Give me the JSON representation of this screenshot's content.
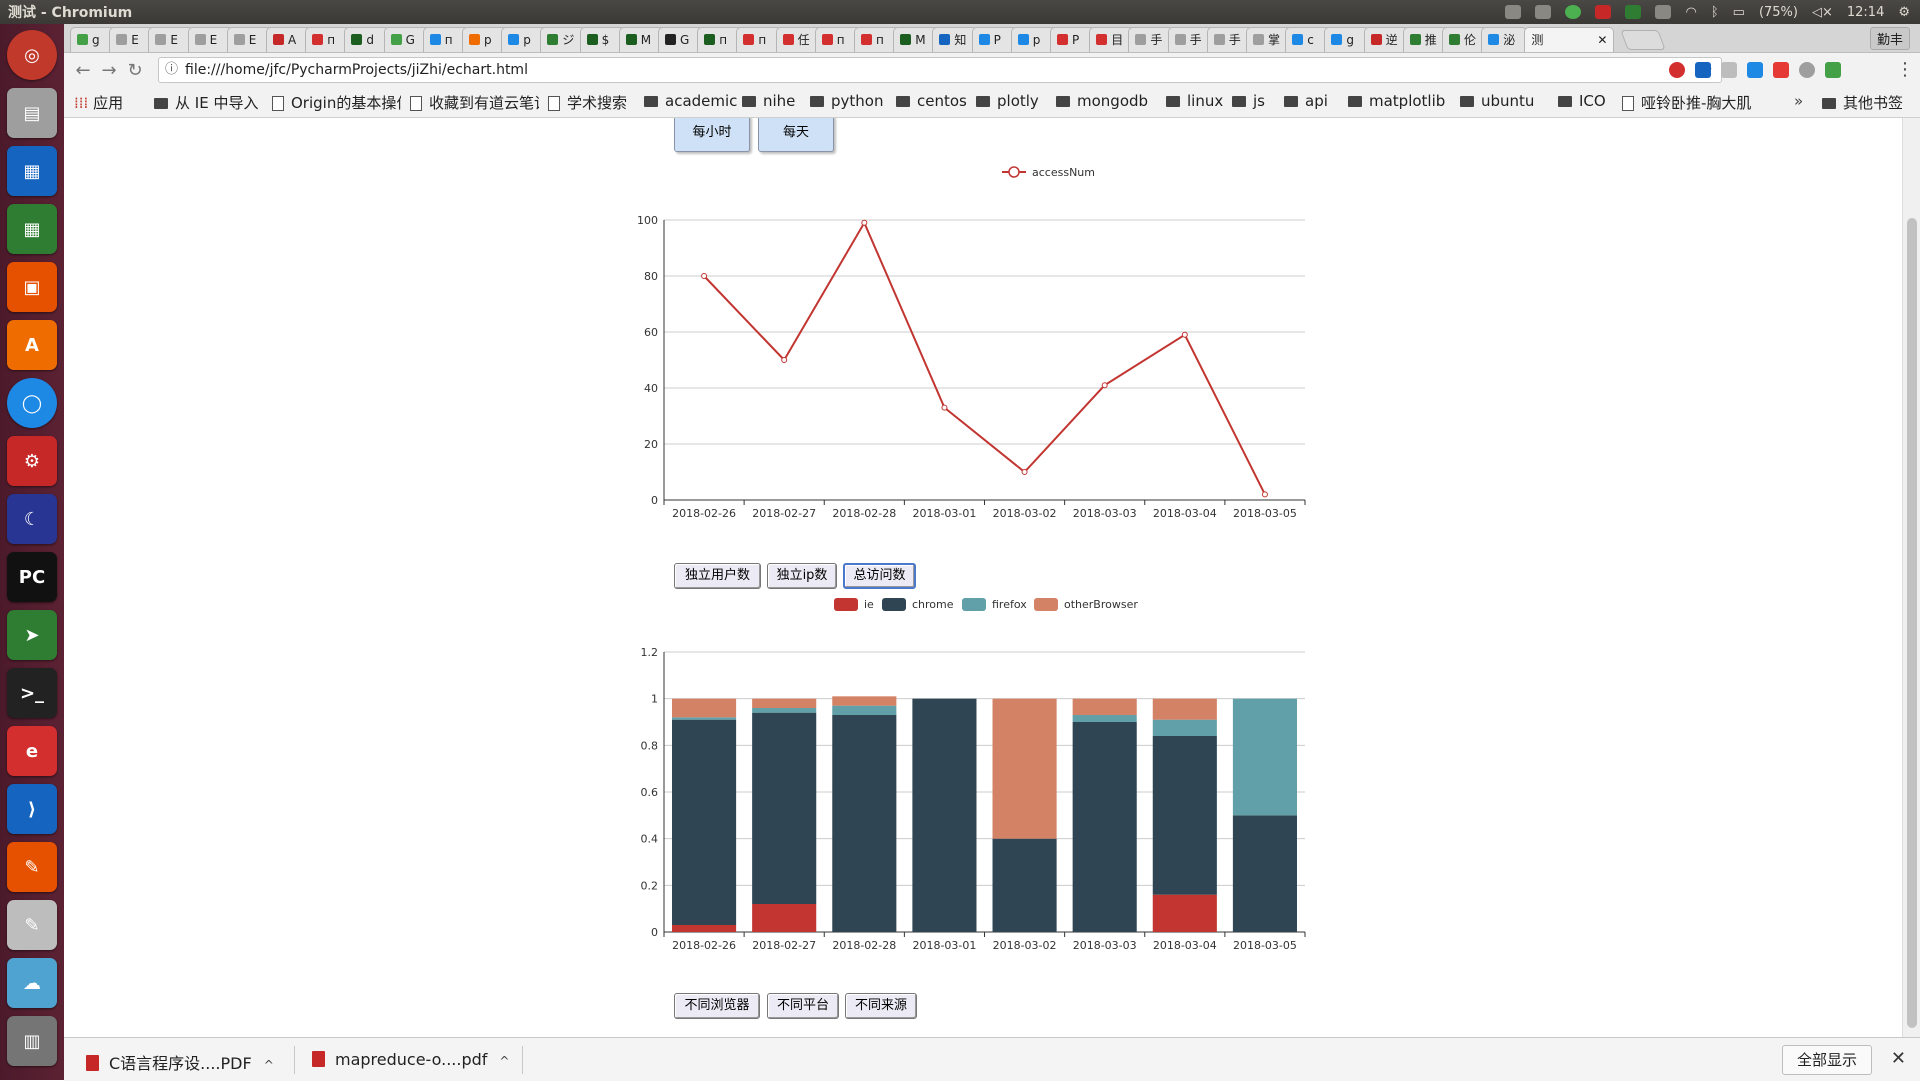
{
  "window": {
    "title": "测试 - Chromium"
  },
  "system": {
    "battery": "(75%)",
    "time": "12:14"
  },
  "tabs": {
    "items": [
      "g",
      "E",
      "E",
      "E",
      "E",
      "A",
      "п",
      "d",
      "G",
      "п",
      "р",
      "р",
      "ジ",
      "$",
      "M",
      "G",
      "п",
      "п",
      "任",
      "п",
      "п",
      "M",
      "知",
      "P",
      "р",
      "P",
      "目",
      "手",
      "手",
      "手",
      "掌",
      "c",
      "g",
      "逆",
      "推",
      "伦",
      "泌"
    ],
    "active": "测",
    "close": "✕",
    "menu_label": "勤丰"
  },
  "toolbar": {
    "url": "file:///home/jfc/PycharmProjects/jiZhi/echart.html",
    "back_icon": "back-arrow-icon",
    "forward_icon": "forward-arrow-icon",
    "reload_icon": "reload-icon"
  },
  "bookmarks": {
    "items": [
      {
        "label": "应用",
        "kind": "apps"
      },
      {
        "label": "从 IE 中导入",
        "kind": "folder"
      },
      {
        "label": "Origin的基本操作",
        "kind": "page"
      },
      {
        "label": "收藏到有道云笔记",
        "kind": "page"
      },
      {
        "label": "学术搜索",
        "kind": "page"
      },
      {
        "label": "academic",
        "kind": "folder"
      },
      {
        "label": "nihe",
        "kind": "folder"
      },
      {
        "label": "python",
        "kind": "folder"
      },
      {
        "label": "centos",
        "kind": "folder"
      },
      {
        "label": "plotly",
        "kind": "folder"
      },
      {
        "label": "mongodb",
        "kind": "folder"
      },
      {
        "label": "linux",
        "kind": "folder"
      },
      {
        "label": "js",
        "kind": "folder"
      },
      {
        "label": "api",
        "kind": "folder"
      },
      {
        "label": "matplotlib",
        "kind": "folder"
      },
      {
        "label": "ubuntu",
        "kind": "folder"
      },
      {
        "label": "ICO",
        "kind": "folder"
      },
      {
        "label": "哑铃卧推-胸大肌",
        "kind": "page"
      }
    ],
    "overflow": "»",
    "other": "其他书签"
  },
  "controls": {
    "granularity": [
      "每小时",
      "每天"
    ],
    "metric": [
      "独立用户数",
      "独立ip数",
      "总访问数"
    ],
    "metric_selected": 2,
    "dimension": [
      "不同浏览器",
      "不同平台",
      "不同来源"
    ]
  },
  "chart_data": [
    {
      "type": "line",
      "x": [
        "2018-02-26",
        "2018-02-27",
        "2018-02-28",
        "2018-03-01",
        "2018-03-02",
        "2018-03-03",
        "2018-03-04",
        "2018-03-05"
      ],
      "series": [
        {
          "name": "accessNum",
          "values": [
            80,
            50,
            99,
            33,
            10,
            41,
            59,
            2
          ],
          "color": "#c23531"
        }
      ],
      "ylim": [
        0,
        100
      ],
      "yticks": [
        0,
        20,
        40,
        60,
        80,
        100
      ],
      "grid": true,
      "legend": "top-center"
    },
    {
      "type": "bar",
      "stacked": true,
      "categories": [
        "2018-02-26",
        "2018-02-27",
        "2018-02-28",
        "2018-03-01",
        "2018-03-02",
        "2018-03-03",
        "2018-03-04",
        "2018-03-05"
      ],
      "series": [
        {
          "name": "ie",
          "color": "#c23531",
          "values": [
            0.03,
            0.12,
            0,
            0,
            0,
            0,
            0.16,
            0
          ]
        },
        {
          "name": "chrome",
          "color": "#2f4554",
          "values": [
            0.88,
            0.82,
            0.93,
            1.0,
            0.4,
            0.9,
            0.68,
            0.5
          ]
        },
        {
          "name": "firefox",
          "color": "#61a0a8",
          "values": [
            0.01,
            0.02,
            0.04,
            0,
            0,
            0.03,
            0.07,
            0.5
          ]
        },
        {
          "name": "otherBrowser",
          "color": "#d48265",
          "values": [
            0.08,
            0.04,
            0.04,
            0,
            0.6,
            0.07,
            0.09,
            0
          ]
        }
      ],
      "ylim": [
        0,
        1.2
      ],
      "yticks": [
        "0",
        "0.2",
        "0.4",
        "0.6",
        "0.8",
        "1",
        "1.2"
      ],
      "grid": true,
      "legend": "top-center"
    }
  ],
  "downloads": {
    "items": [
      "C语言程序设....PDF",
      "mapreduce-o....pdf"
    ],
    "show_all": "全部显示",
    "close": "✕"
  }
}
